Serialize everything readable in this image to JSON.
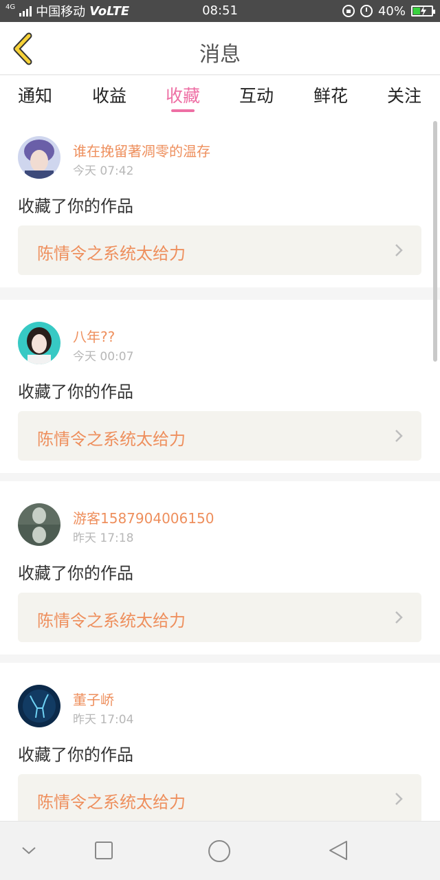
{
  "status_bar": {
    "network_type": "4G",
    "carrier": "中国移动",
    "volte": "VoLTE",
    "time": "08:51",
    "battery_percent": "40%",
    "battery_level": 0.4,
    "icons": [
      "signal-icon",
      "lock-rotation-icon",
      "alarm-icon",
      "battery-charging-icon"
    ]
  },
  "header": {
    "title": "消息",
    "back_icon": "chevron-left-icon"
  },
  "tabs": [
    {
      "label": "通知",
      "active": false
    },
    {
      "label": "收益",
      "active": false
    },
    {
      "label": "收藏",
      "active": true
    },
    {
      "label": "互动",
      "active": false
    },
    {
      "label": "鲜花",
      "active": false
    },
    {
      "label": "关注",
      "active": false
    }
  ],
  "messages": [
    {
      "username": "谁在挽留著凋零的温存",
      "time": "今天 07:42",
      "action": "收藏了你的作品",
      "work": "陈情令之系统太给力"
    },
    {
      "username": "八年??",
      "time": "今天 00:07",
      "action": "收藏了你的作品",
      "work": "陈情令之系统太给力"
    },
    {
      "username": "游客1587904006150",
      "time": "昨天 17:18",
      "action": "收藏了你的作品",
      "work": "陈情令之系统太给力"
    },
    {
      "username": "董子峤",
      "time": "昨天 17:04",
      "action": "收藏了你的作品",
      "work": "陈情令之系统太给力"
    }
  ],
  "colors": {
    "accent": "#ee6fa4",
    "name_orange": "#ee8f5d",
    "back_yellow": "#f7d238"
  },
  "nav_bar": {
    "icons": [
      "collapse-chevron-icon",
      "recent-apps-icon",
      "home-icon",
      "back-triangle-icon"
    ]
  }
}
